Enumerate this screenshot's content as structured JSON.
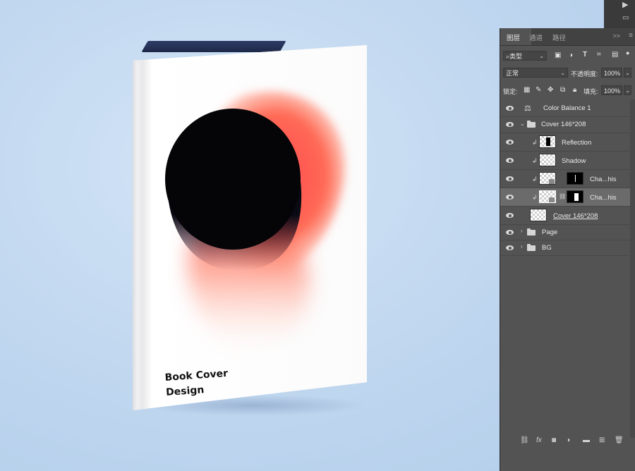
{
  "book": {
    "title": "Book Cover\nDesign",
    "colors": {
      "blob_dark": "#0a0a12",
      "blob_glow": "#ff5a4e",
      "cover": "#ffffff"
    }
  },
  "panel": {
    "tabs": [
      {
        "label": "图层",
        "active": true
      },
      {
        "label": "通道",
        "active": false
      },
      {
        "label": "路径",
        "active": false
      }
    ],
    "tabs_collapse": ">>",
    "filter": {
      "label": "类型",
      "icon": "search-icon"
    },
    "filter_icons": [
      "image-filter-icon",
      "adjustment-filter-icon",
      "type-filter-icon",
      "shape-filter-icon",
      "smart-object-filter-icon"
    ],
    "blend_mode": "正常",
    "opacity_label": "不透明度:",
    "opacity_value": "100%",
    "lock_label": "锁定:",
    "lock_icons": [
      "lock-transparency-icon",
      "lock-pixels-icon",
      "lock-position-icon",
      "lock-artboard-icon",
      "lock-all-icon"
    ],
    "fill_label": "填充:",
    "fill_value": "100%",
    "layers": [
      {
        "name": "Color Balance 1",
        "type": "adjustment",
        "icon": "color-balance-icon"
      },
      {
        "name": "Cover 146*208",
        "type": "group",
        "expanded": true
      },
      {
        "name": "Reflection",
        "type": "layer",
        "clipped": true
      },
      {
        "name": "Shadow",
        "type": "layer",
        "clipped": true
      },
      {
        "name": "Cha...his",
        "type": "smart-masked",
        "clipped": true
      },
      {
        "name": "Cha...his",
        "type": "smart-masked",
        "clipped": true,
        "selected": true
      },
      {
        "name": "Cover 146*208 ",
        "type": "layer",
        "underlined": true
      },
      {
        "name": "Page",
        "type": "group",
        "expanded": false
      },
      {
        "name": "BG",
        "type": "group",
        "expanded": false
      }
    ],
    "bottom_icons": [
      "link-layers-icon",
      "fx-icon",
      "add-mask-icon",
      "adjustment-layer-icon",
      "new-group-icon",
      "new-layer-icon",
      "trash-icon"
    ]
  }
}
